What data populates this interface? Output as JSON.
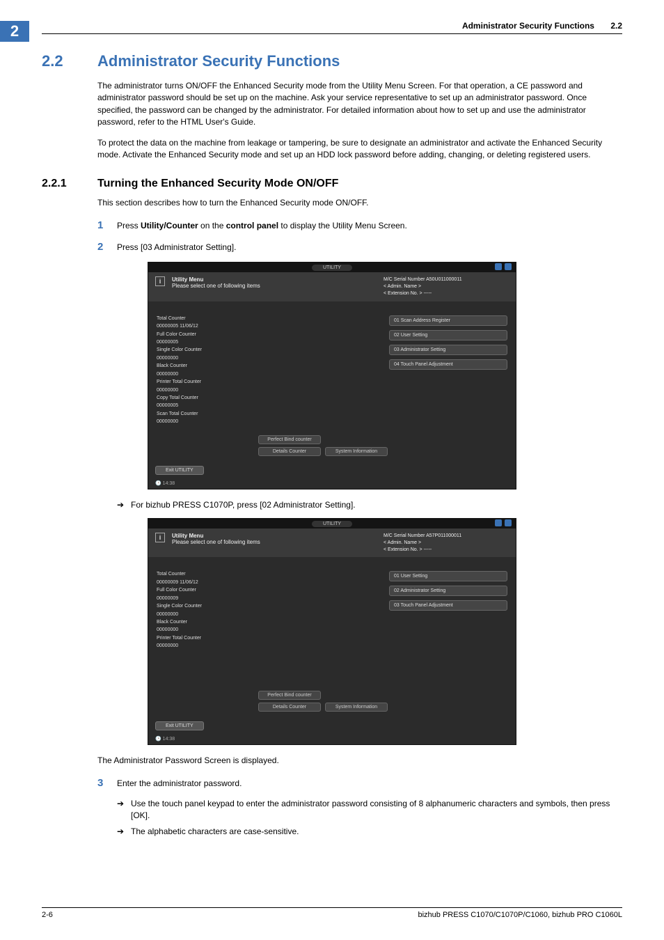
{
  "chapter_tab": "2",
  "running_header": {
    "title": "Administrator Security Functions",
    "secnum": "2.2"
  },
  "h1": {
    "num": "2.2",
    "title": "Administrator Security Functions"
  },
  "para1": "The administrator turns ON/OFF the Enhanced Security mode from the Utility Menu Screen. For that operation, a CE password and administrator password should be set up on the machine. Ask your service representative to set up an administrator password. Once specified, the password can be changed by the administrator. For detailed information about how to set up and use the administrator password, refer to the HTML User's Guide.",
  "para2": "To protect the data on the machine from leakage or tampering, be sure to designate an administrator and activate the Enhanced Security mode. Activate the Enhanced Security mode and set up an HDD lock password before adding, changing, or deleting registered users.",
  "h2": {
    "num": "2.2.1",
    "title": "Turning the Enhanced Security Mode ON/OFF"
  },
  "para3": "This section describes how to turn the Enhanced Security mode ON/OFF.",
  "steps": {
    "s1_num": "1",
    "s1_a": "Press ",
    "s1_b": "Utility/Counter",
    "s1_c": " on the ",
    "s1_d": "control panel",
    "s1_e": " to display the Utility Menu Screen.",
    "s2_num": "2",
    "s2": "Press [03 Administrator Setting].",
    "s3_num": "3",
    "s3": "Enter the administrator password."
  },
  "arrow_a": "For bizhub PRESS C1070P, press [02 Administrator Setting].",
  "arrow_b": "Use the touch panel keypad to enter the administrator password consisting of 8 alphanumeric characters and symbols, then press [OK].",
  "arrow_c": "The alphabetic characters are case-sensitive.",
  "after_para": "The Administrator Password Screen is displayed.",
  "ss_common": {
    "toplabel": "UTILITY",
    "util_title": "Utility Menu",
    "util_sub": "Please select one of following items",
    "admin_name": "< Admin. Name >",
    "ext_no": "< Extension No. >  -----",
    "exit": "Exit UTILITY",
    "time": "14:38",
    "cbtn1": "Perfect Bind counter",
    "cbtn2": "Details Counter",
    "cbtn3": "System Information"
  },
  "ss1": {
    "serial": "M/C Serial Number  A50U011000011",
    "left": [
      "Total Counter",
      "00000005   11/06/12",
      "Full Color Counter",
      "00000005",
      "Single Color Counter",
      "00000000",
      "Black Counter",
      "00000000",
      "Printer Total Counter",
      "00000000",
      "Copy Total Counter",
      "00000005",
      "Scan Total Counter",
      "00000000"
    ],
    "right": [
      "01 Scan Address Register",
      "02 User Setting",
      "03 Administrator Setting",
      "04 Touch Panel Adjustment"
    ]
  },
  "ss2": {
    "serial": "M/C Serial Number  A57P011000011",
    "left": [
      "Total Counter",
      "00000009   11/06/12",
      "Full Color Counter",
      "00000009",
      "Single Color Counter",
      "00000000",
      "Black Counter",
      "00000000",
      "Printer Total Counter",
      "00000000"
    ],
    "right": [
      "01 User Setting",
      "02 Administrator Setting",
      "03 Touch Panel Adjustment"
    ]
  },
  "footer": {
    "pagenum": "2-6",
    "product": "bizhub PRESS C1070/C1070P/C1060, bizhub PRO C1060L"
  }
}
